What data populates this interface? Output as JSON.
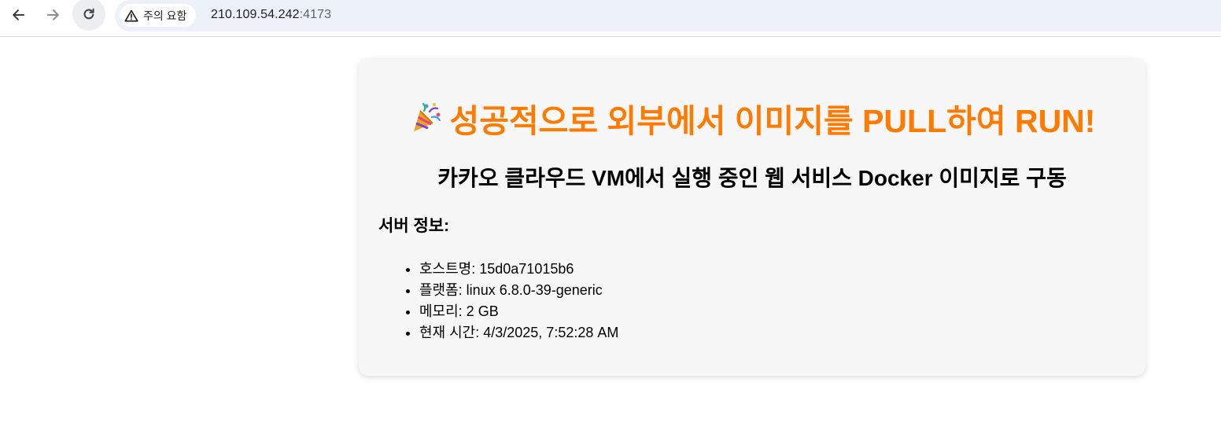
{
  "browser": {
    "security_chip_label": "주의 요함",
    "url_host": "210.109.54.242",
    "url_port": ":4173",
    "icons": {
      "back": "back-arrow-icon",
      "forward": "forward-arrow-icon",
      "reload": "reload-icon",
      "security": "warning-triangle-icon"
    }
  },
  "page": {
    "headline_text": "성공적으로 외부에서 이미지를 PULL하여 RUN!",
    "headline_icon": "party-popper-icon",
    "subheading": "카카오 클라우드 VM에서 실행 중인 웹 서비스 Docker 이미지로 구동",
    "info_title": "서버 정보:",
    "info_items": [
      "호스트명: 15d0a71015b6",
      "플랫폼: linux 6.8.0-39-generic",
      "메모리: 2 GB",
      "현재 시간: 4/3/2025, 7:52:28 AM"
    ]
  },
  "colors": {
    "headline": "#ff7a00",
    "card_background": "#f7f7f7",
    "omnibox_background": "#edf2fa"
  }
}
